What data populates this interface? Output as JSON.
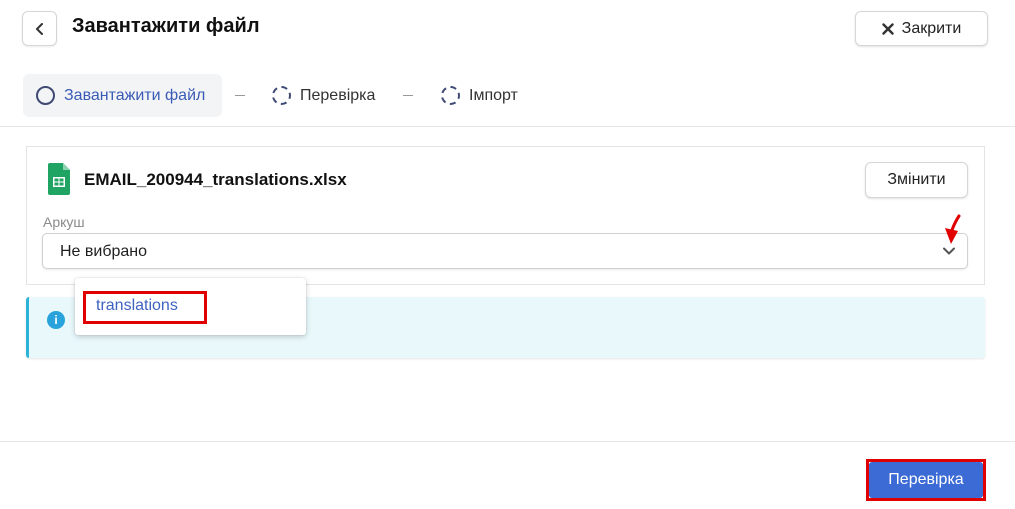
{
  "header": {
    "title": "Завантажити файл",
    "close_label": "Закрити"
  },
  "stepper": {
    "steps": [
      {
        "label": "Завантажити файл",
        "state": "active"
      },
      {
        "label": "Перевірка",
        "state": "pending"
      },
      {
        "label": "Імпорт",
        "state": "pending"
      }
    ],
    "separator": "–"
  },
  "file": {
    "name": "EMAIL_200944_translations.xlsx",
    "change_label": "Змінити",
    "icon": "spreadsheet-icon"
  },
  "sheet": {
    "label": "Аркуш",
    "value": "Не вибрано",
    "options": [
      "translations"
    ]
  },
  "info": {
    "icon": "info-icon",
    "icon_glyph": "i"
  },
  "footer": {
    "primary_label": "Перевірка"
  },
  "colors": {
    "accent": "#3c6bd5",
    "active_step_text": "#3a5bb5",
    "info_bg": "#e8f8fb",
    "info_border": "#2cb3d8",
    "annotation": "#e00000"
  }
}
